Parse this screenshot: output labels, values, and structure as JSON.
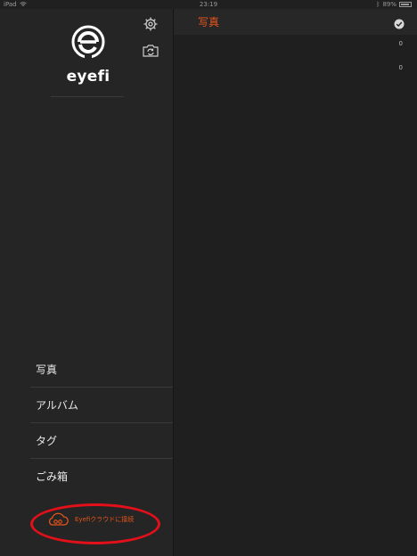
{
  "status_bar": {
    "carrier": "iPad",
    "time": "23:19",
    "battery_percent": "89%"
  },
  "sidebar": {
    "logo_text": "eyefi",
    "icons": [
      "gear-icon",
      "camera-sync-icon"
    ],
    "nav_items": [
      {
        "label": "写真"
      },
      {
        "label": "アルバム"
      },
      {
        "label": "タグ"
      },
      {
        "label": "ごみ箱"
      }
    ],
    "cloud_link": {
      "label": "Eyefiクラウドに接続",
      "icon": "cloud-link-icon"
    }
  },
  "main": {
    "title": "写真",
    "select_icon": "checkmark-circle-icon",
    "counts": [
      "0",
      "0"
    ]
  },
  "colors": {
    "accent": "#e8541a",
    "annotation_ring": "#e3101a",
    "sidebar_bg": "#252525",
    "main_bg": "#1f1f1f"
  }
}
